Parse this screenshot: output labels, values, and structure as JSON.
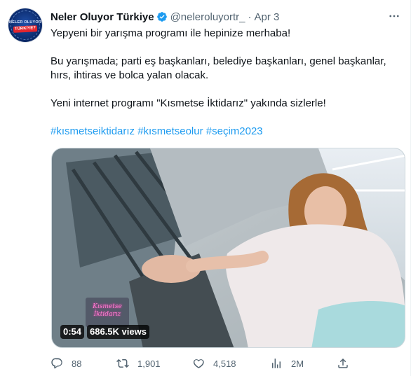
{
  "tweet": {
    "author_name": "Neler Oluyor Türkiye",
    "handle": "@neleroluyortr_",
    "separator": "·",
    "time": "Apr 3",
    "avatar_text_top": "NELER OLUYOR",
    "avatar_text_bottom": "TÜRKİYE?",
    "text_lines": [
      "Yepyeni bir yarışma programı ile hepinize merhaba!",
      "Bu yarışmada; parti eş başkanları, belediye başkanları, genel başkanlar,",
      "hırs, ihtiras ve bolca yalan olacak.",
      "Yeni internet programı \"Kısmetse İktidarız\" yakında sizlerle!"
    ],
    "hashtags": [
      "#kısmetseiktidarız",
      "#kısmetseolur",
      "#seçim2023"
    ],
    "media": {
      "duration": "0:54",
      "views": "686.5K views",
      "logo_text": "Kısmetse İktidarız"
    },
    "actions": {
      "replies": "88",
      "retweets": "1,901",
      "likes": "4,518",
      "views": "2M"
    }
  },
  "icons": {
    "verified": "verified-badge-icon",
    "more": "more-icon",
    "reply": "reply-icon",
    "retweet": "retweet-icon",
    "like": "like-icon",
    "analytics": "analytics-icon",
    "share": "share-icon"
  },
  "colors": {
    "link": "#1d9bf0",
    "muted": "#536471",
    "text": "#0f1419"
  }
}
